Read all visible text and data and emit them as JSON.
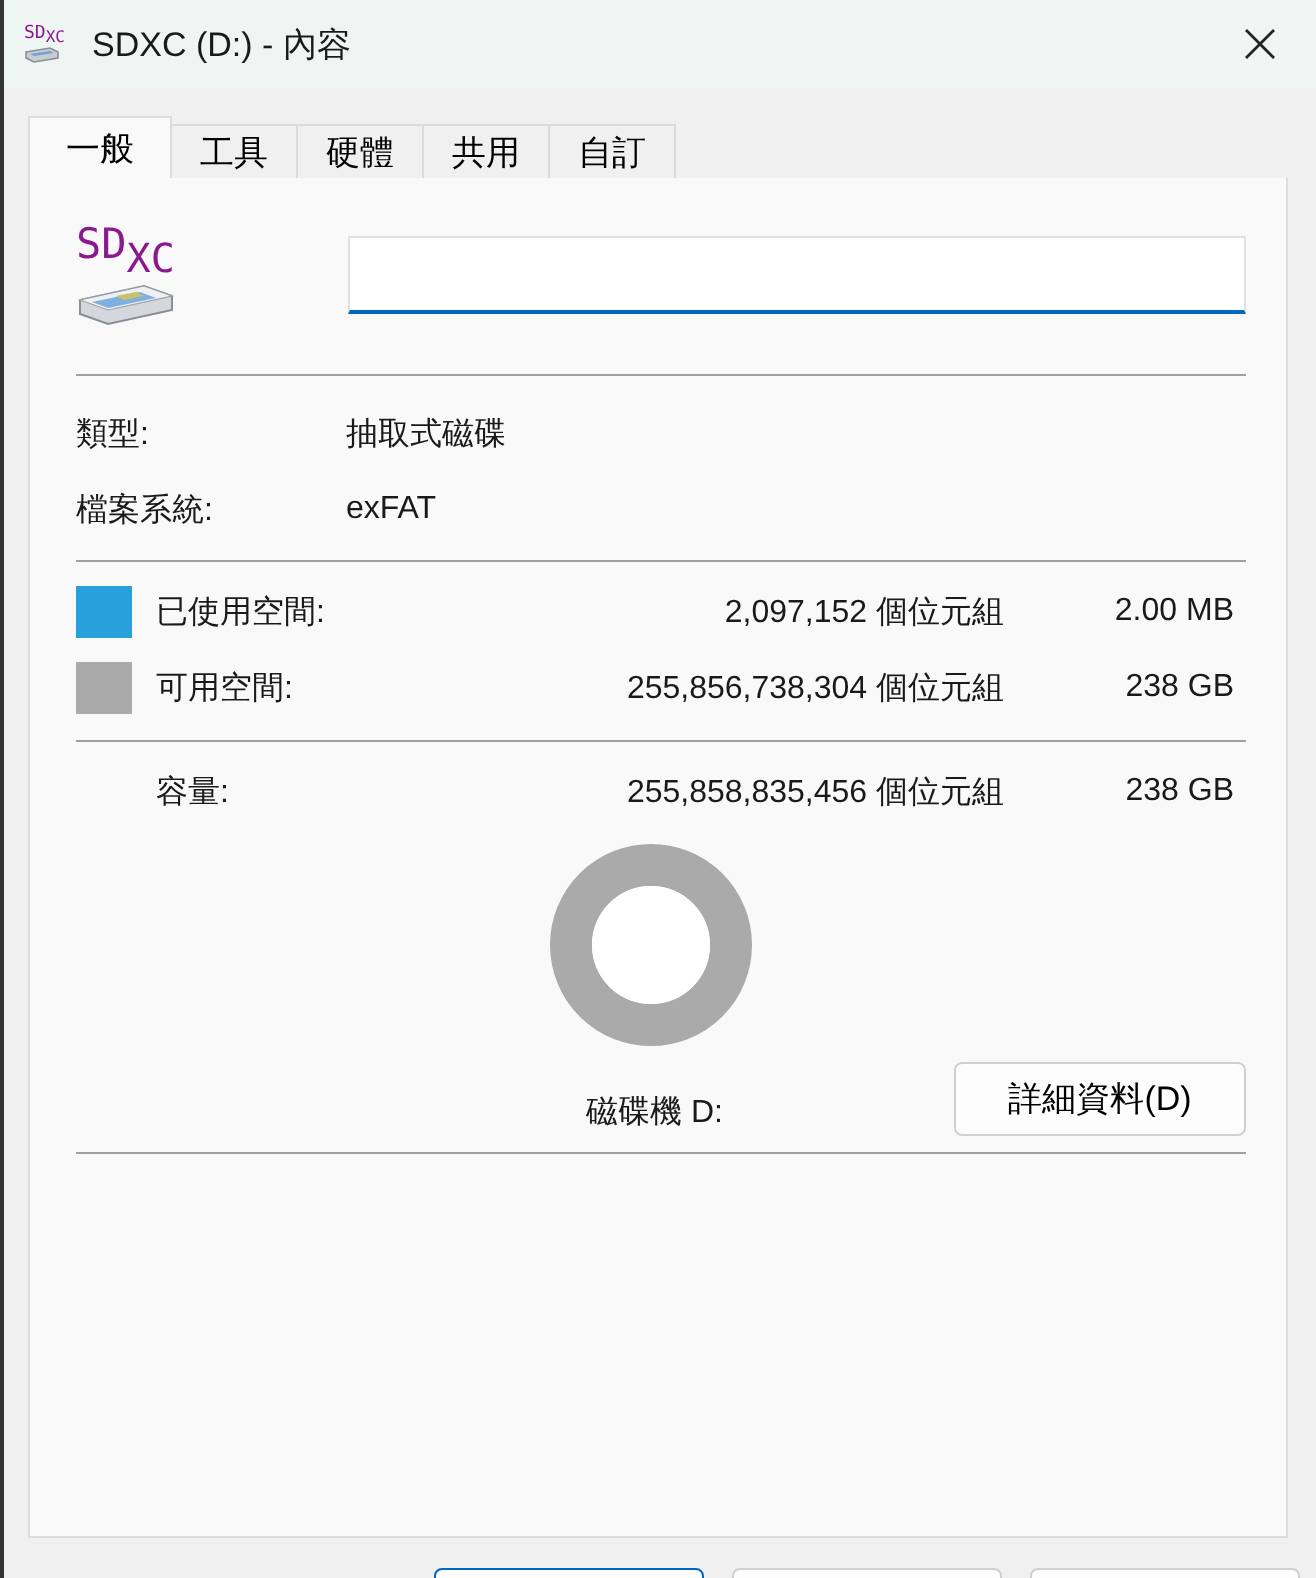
{
  "window": {
    "title": "SDXC (D:) - 內容",
    "icon_label": "SD$_{XC}$"
  },
  "tabs": [
    {
      "label": "一般",
      "selected": true
    },
    {
      "label": "工具",
      "selected": false
    },
    {
      "label": "硬體",
      "selected": false
    },
    {
      "label": "共用",
      "selected": false
    },
    {
      "label": "自訂",
      "selected": false
    }
  ],
  "drive": {
    "icon_label": "SD$_{XC}$"
  },
  "info": [
    {
      "label": "類型:",
      "value": "抽取式磁碟"
    },
    {
      "label": "檔案系統:",
      "value": "exFAT"
    }
  ],
  "usage": [
    {
      "label": "已使用空間:",
      "bytes": "2,097,152 個位元組",
      "size": "2.00 MB",
      "color": "#27a0dc"
    },
    {
      "label": "可用空間:",
      "bytes": "255,856,738,304 個位元組",
      "size": "238 GB",
      "color": "#aaaaaa"
    }
  ],
  "capacity": {
    "label": "容量:",
    "bytes": "255,858,835,456 個位元組",
    "size": "238 GB"
  },
  "drive_label": "磁碟機 D:",
  "details_button": "詳細資料(D)",
  "bottom_buttons": [
    {
      "default": true
    },
    {
      "default": false
    },
    {
      "default": false
    }
  ]
}
